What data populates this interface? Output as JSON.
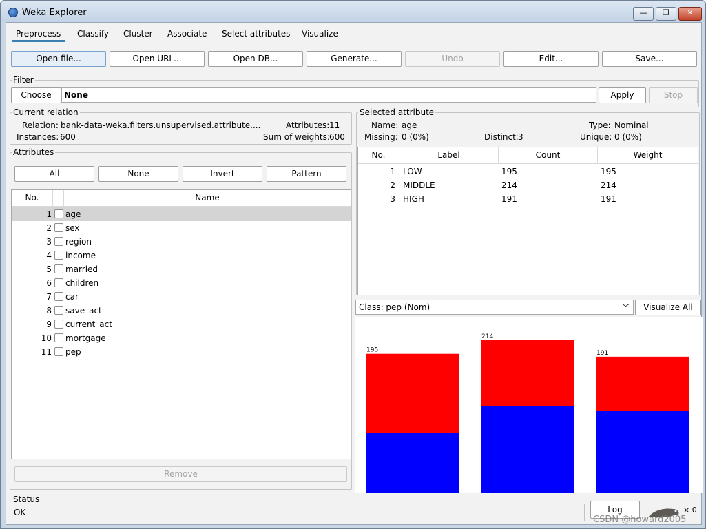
{
  "window": {
    "title": "Weka Explorer",
    "minimize_glyph": "—",
    "restore_glyph": "❐",
    "close_glyph": "✕"
  },
  "tabs": [
    {
      "label": "Preprocess"
    },
    {
      "label": "Classify"
    },
    {
      "label": "Cluster"
    },
    {
      "label": "Associate"
    },
    {
      "label": "Select attributes"
    },
    {
      "label": "Visualize"
    }
  ],
  "toolbar": {
    "open_file": "Open file...",
    "open_url": "Open URL...",
    "open_db": "Open DB...",
    "generate": "Generate...",
    "undo": "Undo",
    "edit": "Edit...",
    "save": "Save..."
  },
  "filter": {
    "section": "Filter",
    "choose": "Choose",
    "value": "None",
    "apply": "Apply",
    "stop": "Stop"
  },
  "current_relation": {
    "section": "Current relation",
    "relation_label": "Relation:",
    "relation_value": "bank-data-weka.filters.unsupervised.attribute....",
    "attributes_label": "Attributes:",
    "attributes_value": "11",
    "instances_label": "Instances:",
    "instances_value": "600",
    "sow_label": "Sum of weights:",
    "sow_value": "600"
  },
  "attributes": {
    "section": "Attributes",
    "all": "All",
    "none": "None",
    "invert": "Invert",
    "pattern": "Pattern",
    "col_no": "No.",
    "col_name": "Name",
    "rows": [
      {
        "no": "1",
        "name": "age"
      },
      {
        "no": "2",
        "name": "sex"
      },
      {
        "no": "3",
        "name": "region"
      },
      {
        "no": "4",
        "name": "income"
      },
      {
        "no": "5",
        "name": "married"
      },
      {
        "no": "6",
        "name": "children"
      },
      {
        "no": "7",
        "name": "car"
      },
      {
        "no": "8",
        "name": "save_act"
      },
      {
        "no": "9",
        "name": "current_act"
      },
      {
        "no": "10",
        "name": "mortgage"
      },
      {
        "no": "11",
        "name": "pep"
      }
    ],
    "remove": "Remove"
  },
  "selected_attribute": {
    "section": "Selected attribute",
    "name_label": "Name:",
    "name_value": "age",
    "type_label": "Type:",
    "type_value": "Nominal",
    "missing_label": "Missing:",
    "missing_value": "0 (0%)",
    "distinct_label": "Distinct:",
    "distinct_value": "3",
    "unique_label": "Unique:",
    "unique_value": "0 (0%)",
    "col_no": "No.",
    "col_label": "Label",
    "col_count": "Count",
    "col_weight": "Weight",
    "rows": [
      {
        "no": "1",
        "label": "LOW",
        "count": "195",
        "weight": "195"
      },
      {
        "no": "2",
        "label": "MIDDLE",
        "count": "214",
        "weight": "214"
      },
      {
        "no": "3",
        "label": "HIGH",
        "count": "191",
        "weight": "191"
      }
    ]
  },
  "class_select": {
    "value": "Class: pep (Nom)",
    "visualize_all": "Visualize All"
  },
  "chart_data": {
    "type": "bar",
    "categories": [
      "LOW",
      "MIDDLE",
      "HIGH"
    ],
    "totals": [
      195,
      214,
      191
    ],
    "data_labels": [
      "195",
      "214",
      "191"
    ],
    "stacked": true,
    "series": [
      {
        "color": "#0000ff",
        "values": [
          84,
          122,
          115
        ]
      },
      {
        "color": "#ff0000",
        "values": [
          111,
          92,
          76
        ]
      }
    ],
    "ylim": [
      0,
      214
    ]
  },
  "status": {
    "section": "Status",
    "text": "OK",
    "log": "Log",
    "count": "× 0",
    "watermark": "CSDN @howard2005"
  }
}
